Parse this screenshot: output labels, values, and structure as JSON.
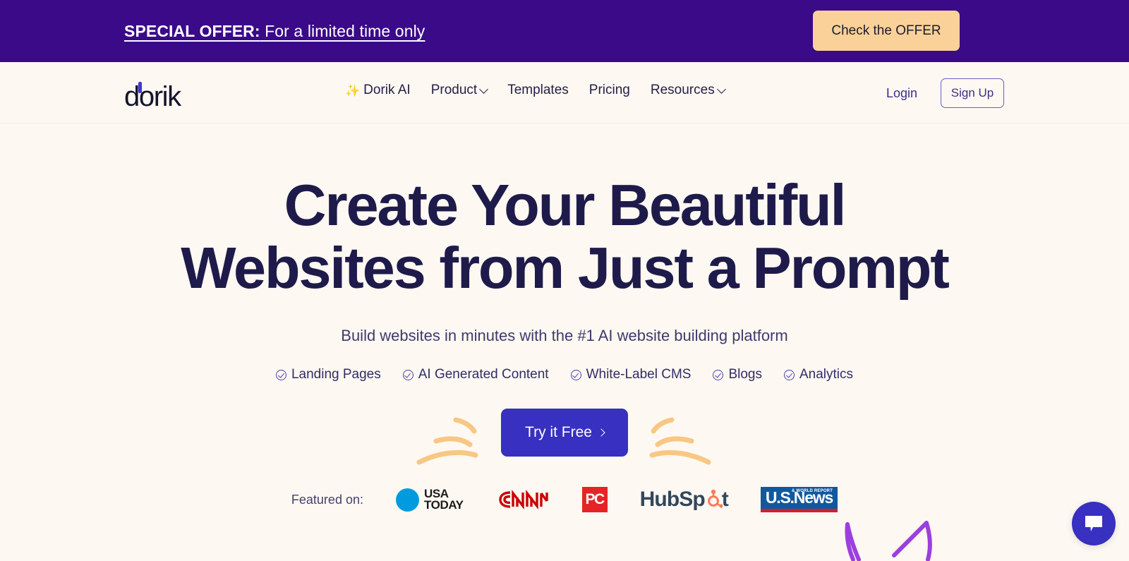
{
  "promo": {
    "bold_text": "SPECIAL OFFER:",
    "rest_text": " For a limited time only",
    "button_label": "Check the OFFER",
    "background_color": "#3a0a88",
    "button_color": "#fbd19a"
  },
  "header": {
    "logo_text": "dorik",
    "nav": [
      {
        "label": "Dorik AI",
        "icon": "sparkle-icon",
        "has_dropdown": false
      },
      {
        "label": "Product",
        "icon": "",
        "has_dropdown": true
      },
      {
        "label": "Templates",
        "icon": "",
        "has_dropdown": false
      },
      {
        "label": "Pricing",
        "icon": "",
        "has_dropdown": false
      },
      {
        "label": "Resources",
        "icon": "",
        "has_dropdown": true
      }
    ],
    "login_label": "Login",
    "signup_label": "Sign Up"
  },
  "hero": {
    "title_line1": "Create Your Beautiful",
    "title_line2": "Websites from Just a Prompt",
    "subtitle": "Build websites in minutes with the #1 AI website building platform",
    "features": [
      "Landing Pages",
      "AI Generated Content",
      "White-Label CMS",
      "Blogs",
      "Analytics"
    ],
    "cta_label": "Try it Free",
    "title_color": "#1e1b4b",
    "cta_color": "#3730c0"
  },
  "featured": {
    "label": "Featured on:",
    "logos": [
      {
        "name": "USA TODAY",
        "line1": "USA",
        "line2": "TODAY",
        "color": "#009bde"
      },
      {
        "name": "CNN",
        "text": "CNN",
        "color": "#cc0000"
      },
      {
        "name": "PC",
        "text": "PC",
        "color": "#e32526"
      },
      {
        "name": "HubSpot",
        "text": "HubSp",
        "text2": "t",
        "color": "#ff7a59"
      },
      {
        "name": "U.S. News & World Report",
        "main": "U.S.News",
        "sub": "& WORLD REPORT",
        "color": "#10599e"
      }
    ]
  },
  "chat": {
    "icon": "chat-bubble-icon",
    "color": "#3730c0"
  }
}
